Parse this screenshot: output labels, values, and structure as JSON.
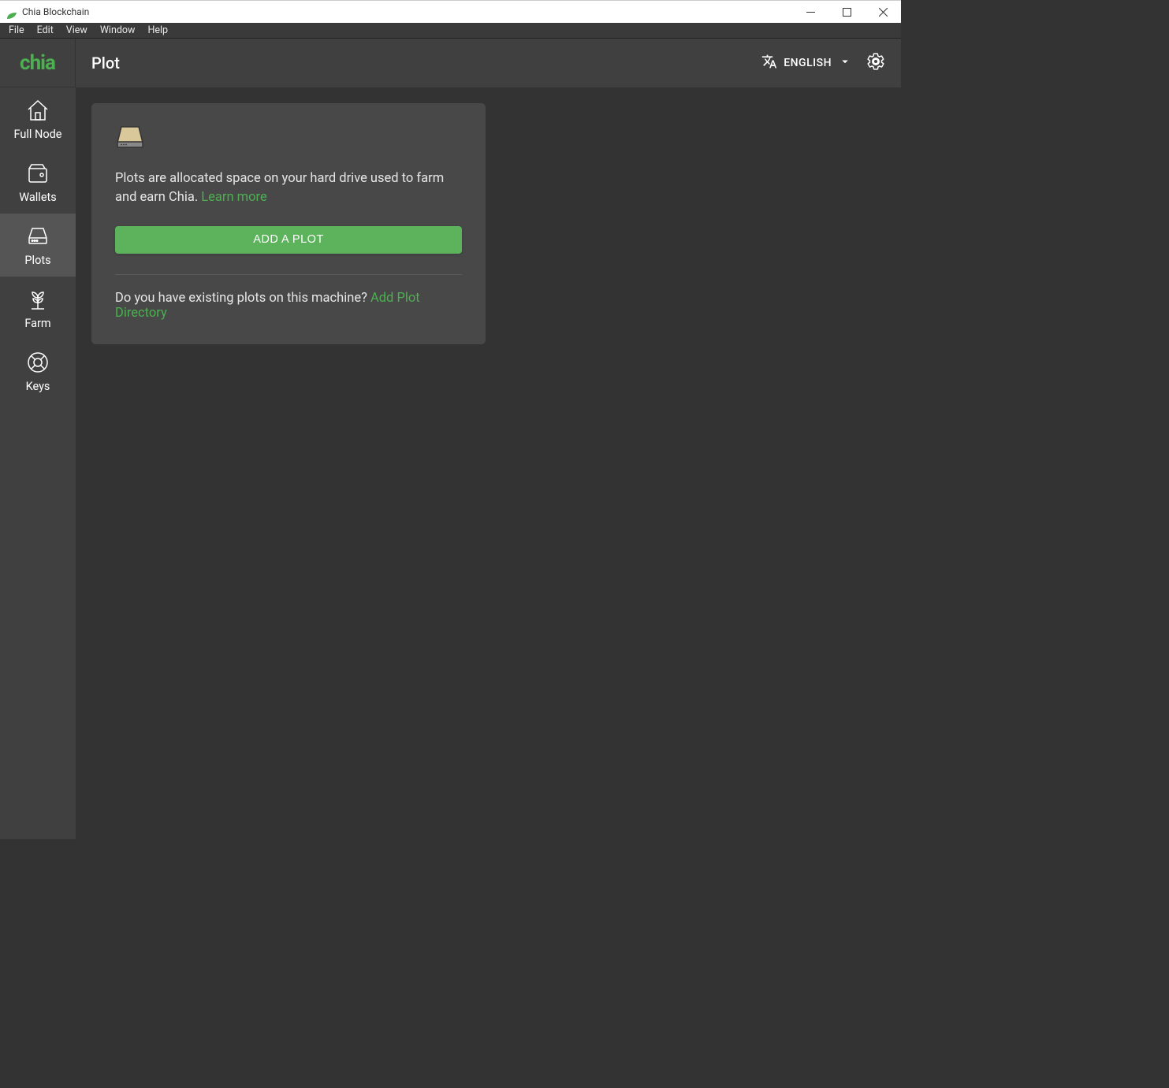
{
  "titlebar": {
    "title": "Chia Blockchain"
  },
  "menubar": {
    "items": [
      "File",
      "Edit",
      "View",
      "Window",
      "Help"
    ]
  },
  "sidebar": {
    "logo": "chia",
    "items": [
      {
        "label": "Full Node"
      },
      {
        "label": "Wallets"
      },
      {
        "label": "Plots"
      },
      {
        "label": "Farm"
      },
      {
        "label": "Keys"
      }
    ]
  },
  "header": {
    "title": "Plot",
    "language": "ENGLISH"
  },
  "card": {
    "description": "Plots are allocated space on your hard drive used to farm and earn Chia. ",
    "learn_more": "Learn more",
    "add_button": "ADD A PLOT",
    "existing_question": "Do you have existing plots on this machine? ",
    "add_directory_link": "Add Plot Directory"
  }
}
